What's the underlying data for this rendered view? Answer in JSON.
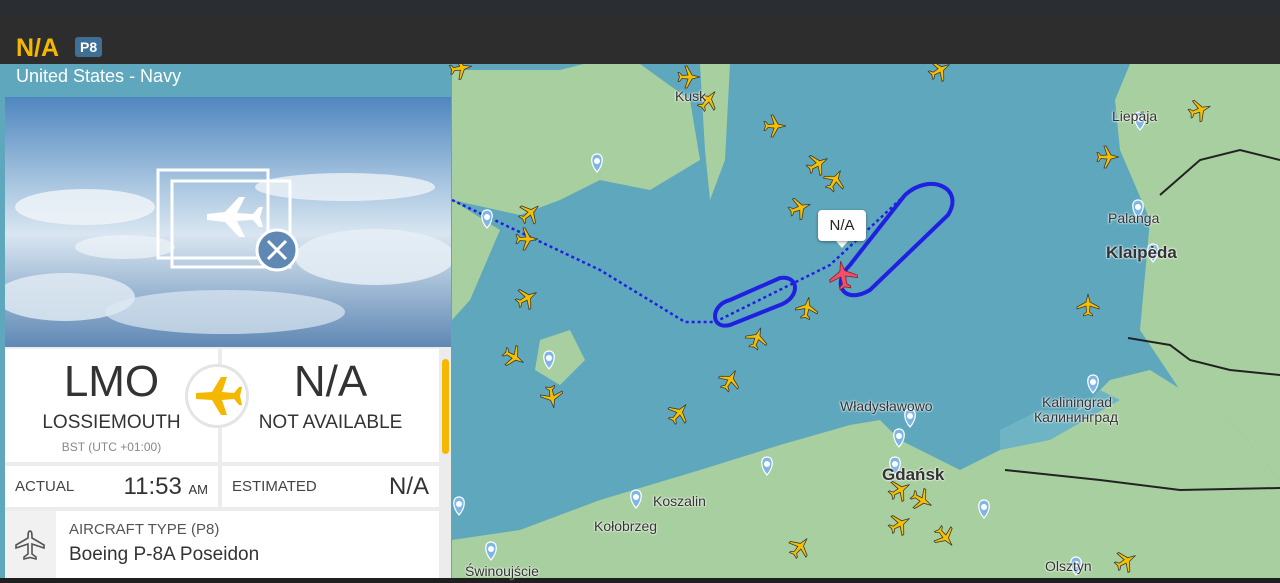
{
  "header": {
    "callsign": "N/A",
    "type_badge": "P8",
    "airline": "United States - Navy"
  },
  "route": {
    "origin": {
      "code": "LMO",
      "name": "LOSSIEMOUTH",
      "timezone": "BST (UTC +01:00)"
    },
    "destination": {
      "code": "N/A",
      "name": "NOT AVAILABLE"
    }
  },
  "times": {
    "actual_label": "ACTUAL",
    "actual_value": "11:53",
    "actual_suffix": "AM",
    "estimated_label": "ESTIMATED",
    "estimated_value": "N/A"
  },
  "aircraft": {
    "label": "AIRCRAFT TYPE",
    "type_code": "(P8)",
    "name": "Boeing P-8A Poseidon"
  },
  "map": {
    "selected_label": "N/A",
    "places": {
      "liepaja": "Liepāja",
      "palanga": "Palanga",
      "klaipeda": "Klaipėda",
      "kaliningrad_lat": "Kaliningrad",
      "kaliningrad_cyr": "Калининград",
      "wladyslawowo": "Władysławowo",
      "gdansk": "Gdańsk",
      "koszalin": "Koszalin",
      "kolobrzeg": "Kołobrzeg",
      "swinoujscie": "Świnoujście",
      "olsztyn": "Olsztyn",
      "kusk": "Kusk"
    },
    "colors": {
      "sea": "#5fa7bd",
      "land": "#a8cf9f",
      "track": "#2020e0",
      "plane": "#f5c000",
      "selected_plane": "#f0506a"
    }
  }
}
